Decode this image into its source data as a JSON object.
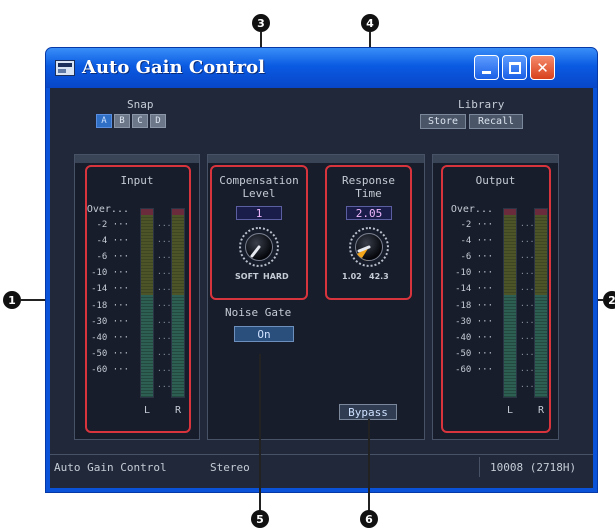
{
  "window": {
    "title": "Auto Gain Control",
    "titlebar_buttons": [
      "minimize",
      "maximize",
      "close"
    ],
    "close_glyph": "✕"
  },
  "snap": {
    "label": "Snap",
    "buttons": [
      "A",
      "B",
      "C",
      "D"
    ],
    "active": "A"
  },
  "library": {
    "label": "Library",
    "store": "Store",
    "recall": "Recall"
  },
  "input": {
    "title": "Input",
    "scale": [
      "Over",
      "-2",
      "-4",
      "-6",
      "-10",
      "-14",
      "-18",
      "-30",
      "-40",
      "-50",
      "-60"
    ],
    "left": "L",
    "right": "R",
    "level_left": 0,
    "level_right": 0
  },
  "output": {
    "title": "Output",
    "scale": [
      "Over",
      "-2",
      "-4",
      "-6",
      "-10",
      "-14",
      "-18",
      "-30",
      "-40",
      "-50",
      "-60"
    ],
    "left": "L",
    "right": "R",
    "level_left": 0,
    "level_right": 0
  },
  "compensation": {
    "title_line1": "Compensation",
    "title_line2": "Level",
    "value": "1",
    "range_min": "SOFT",
    "range_max": "HARD"
  },
  "response": {
    "title_line1": "Response",
    "title_line2": "Time",
    "value": "2.05",
    "range_min": "1.02",
    "range_max": "42.3"
  },
  "noise_gate": {
    "label": "Noise Gate",
    "state": "On"
  },
  "bypass": {
    "label": "Bypass"
  },
  "status": {
    "component": "Auto Gain Control",
    "mode": "Stereo",
    "id": "10008 (2718H)"
  },
  "callouts": [
    "1",
    "2",
    "3",
    "4",
    "5",
    "6"
  ],
  "colors": {
    "titlebar": "#0a5ae2",
    "panel_bg": "#20283a",
    "highlight": "#d8343d",
    "value_text": "#f0b8ff"
  }
}
